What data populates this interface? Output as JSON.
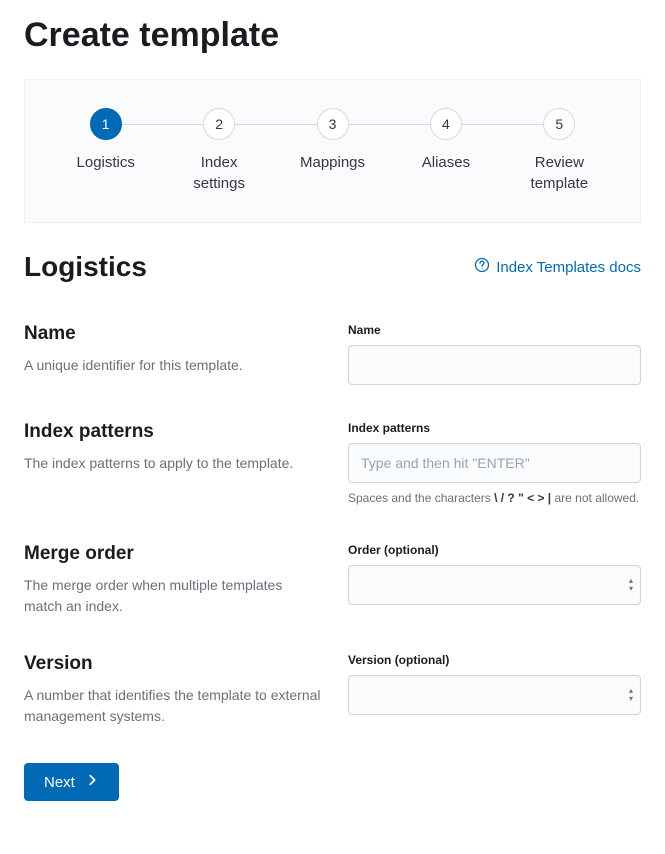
{
  "page": {
    "title": "Create template"
  },
  "steps": [
    {
      "num": "1",
      "label": "Logistics",
      "active": true
    },
    {
      "num": "2",
      "label": "Index settings",
      "active": false
    },
    {
      "num": "3",
      "label": "Mappings",
      "active": false
    },
    {
      "num": "4",
      "label": "Aliases",
      "active": false
    },
    {
      "num": "5",
      "label": "Review template",
      "active": false
    }
  ],
  "section": {
    "title": "Logistics",
    "docs_link": "Index Templates docs"
  },
  "fields": {
    "name": {
      "title": "Name",
      "desc": "A unique identifier for this template.",
      "label": "Name"
    },
    "index_patterns": {
      "title": "Index patterns",
      "desc": "The index patterns to apply to the template.",
      "label": "Index patterns",
      "placeholder": "Type and then hit \"ENTER\"",
      "help_prefix": "Spaces and the characters ",
      "help_chars": "\\ / ? \" < > |",
      "help_suffix": " are not allowed."
    },
    "merge_order": {
      "title": "Merge order",
      "desc": "The merge order when multiple templates match an index.",
      "label": "Order (optional)"
    },
    "version": {
      "title": "Version",
      "desc": "A number that identifies the template to external management systems.",
      "label": "Version (optional)"
    }
  },
  "buttons": {
    "next": "Next"
  }
}
